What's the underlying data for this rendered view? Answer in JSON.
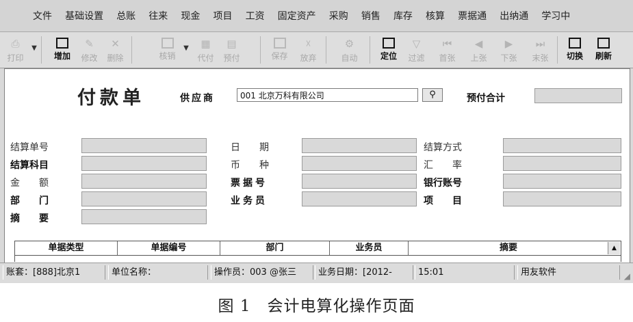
{
  "menu": [
    "文件",
    "基础设置",
    "总账",
    "往来",
    "现金",
    "项目",
    "工资",
    "固定资产",
    "采购",
    "销售",
    "库存",
    "核算",
    "票据通",
    "出纳通",
    "学习中"
  ],
  "toolbar": {
    "print": "打印",
    "add": "增加",
    "edit": "修改",
    "delete": "删除",
    "writeoff": "核销",
    "pay_for": "代付",
    "prepay": "预付",
    "save": "保存",
    "discard": "放弃",
    "auto": "自动",
    "locate": "定位",
    "filter": "过滤",
    "first": "首张",
    "prev": "上张",
    "next": "下张",
    "last": "末张",
    "switch": "切换",
    "refresh": "刷新"
  },
  "form": {
    "title": "付款单",
    "supplier_label": "供应商",
    "supplier_value": "001   北京万科有限公司",
    "prepaid_label": "预付合计",
    "fields": {
      "settle_no": "结算单号",
      "settle_subject": "结算科目",
      "amount": "金　　额",
      "department": "部　　门",
      "summary": "摘　　要",
      "date": "日　　期",
      "currency": "币　　种",
      "bill_no": "票据号",
      "salesperson": "业务员",
      "settle_method": "结算方式",
      "exchange_rate": "汇　　率",
      "bank_account": "银行账号",
      "project": "项　　目"
    },
    "grid_columns": [
      "单据类型",
      "单据编号",
      "部门",
      "业务员",
      "摘要"
    ]
  },
  "status": {
    "account": "账套：[888]北京1",
    "unit": "单位名称：",
    "operator": "操作员：003 @张三",
    "biz_date": "业务日期：[2012-",
    "time": "15:01",
    "vendor": "用友软件"
  },
  "caption": "图 1　会计电算化操作页面"
}
